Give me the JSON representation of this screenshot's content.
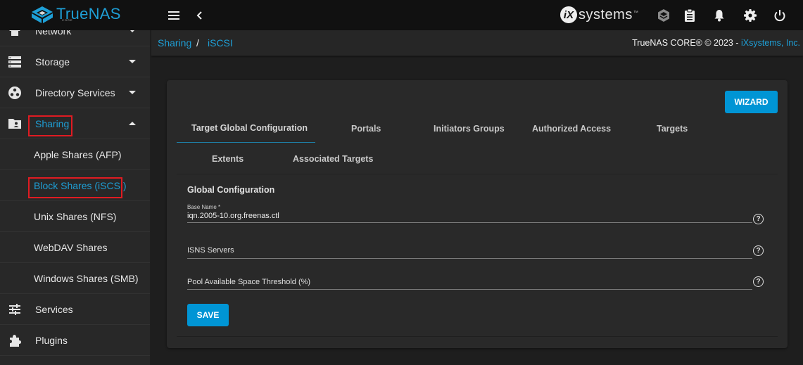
{
  "topbar": {
    "logo_text": "TrueNAS",
    "logo_sub": "CORE",
    "menu_icon": "hamburger-menu-icon",
    "collapse_icon": "chevron-left-icon",
    "vendor_text": "systems",
    "vendor_mark": "iX",
    "vendor_tm": "™",
    "icons": [
      "truecommand-icon",
      "clipboard-icon",
      "bell-icon",
      "gear-icon",
      "power-icon"
    ]
  },
  "sidebar": {
    "items": [
      {
        "label": "Network",
        "icon": "network-icon",
        "caret": "down"
      },
      {
        "label": "Storage",
        "icon": "storage-icon",
        "caret": "down"
      },
      {
        "label": "Directory Services",
        "icon": "directory-services-icon",
        "caret": "down"
      },
      {
        "label": "Sharing",
        "icon": "folder-shared-icon",
        "caret": "up",
        "active": true
      }
    ],
    "sub_items": [
      {
        "label": "Apple Shares (AFP)"
      },
      {
        "label": "Block Shares (iSCSI)",
        "active": true
      },
      {
        "label": "Unix Shares (NFS)"
      },
      {
        "label": "WebDAV Shares"
      },
      {
        "label": "Windows Shares (SMB)"
      }
    ],
    "bottom_items": [
      {
        "label": "Services",
        "icon": "sliders-icon"
      },
      {
        "label": "Plugins",
        "icon": "puzzle-icon"
      }
    ]
  },
  "breadcrumb": {
    "parent": "Sharing",
    "separator": "/",
    "current": "iSCSI"
  },
  "copyright": {
    "text": "TrueNAS CORE® © 2023 - ",
    "link": "iXsystems, Inc."
  },
  "card": {
    "wizard_label": "WIZARD",
    "tabs": [
      {
        "label": "Target Global Configuration",
        "active": true
      },
      {
        "label": "Portals"
      },
      {
        "label": "Initiators Groups"
      },
      {
        "label": "Authorized Access"
      },
      {
        "label": "Targets"
      },
      {
        "label": "Extents"
      },
      {
        "label": "Associated Targets"
      }
    ],
    "section_title": "Global Configuration",
    "fields": [
      {
        "label": "Base Name *",
        "value": "iqn.2005-10.org.freenas.ctl",
        "placeholder": ""
      },
      {
        "label": "",
        "value": "",
        "placeholder": "ISNS Servers"
      },
      {
        "label": "",
        "value": "",
        "placeholder": "Pool Available Space Threshold (%)"
      }
    ],
    "help_glyph": "?",
    "save_label": "SAVE"
  },
  "colors": {
    "accent": "#1e9fd6",
    "button": "#0095d5",
    "highlight_box": "#e01b22",
    "topbar_bg": "#111111",
    "sidebar_bg": "#282828",
    "card_bg": "#292929"
  }
}
